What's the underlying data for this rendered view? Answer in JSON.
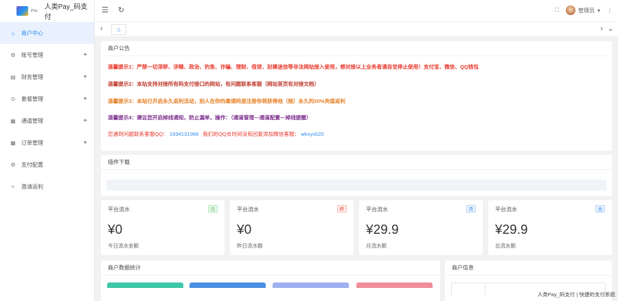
{
  "app": {
    "logo_small": "iPay",
    "title": "人类Pay_码支付"
  },
  "sidebar": {
    "items": [
      {
        "label": "商户中心",
        "icon": "home-icon",
        "glyph": "⌂",
        "active": true,
        "expandable": false
      },
      {
        "label": "账号管理",
        "icon": "gear-icon",
        "glyph": "⚙",
        "active": false,
        "expandable": true
      },
      {
        "label": "财务管理",
        "icon": "finance-icon",
        "glyph": "▤",
        "active": false,
        "expandable": true
      },
      {
        "label": "套餐管理",
        "icon": "package-icon",
        "glyph": "⊙",
        "active": false,
        "expandable": true
      },
      {
        "label": "通道管理",
        "icon": "channel-icon",
        "glyph": "▦",
        "active": false,
        "expandable": true
      },
      {
        "label": "订单管理",
        "icon": "order-icon",
        "glyph": "▦",
        "active": false,
        "expandable": true
      },
      {
        "label": "支付配置",
        "icon": "settings-icon",
        "glyph": "⚙",
        "active": false,
        "expandable": false
      },
      {
        "label": "邀请返利",
        "icon": "share-icon",
        "glyph": "<",
        "active": false,
        "expandable": false
      }
    ],
    "expand_glyph": "+"
  },
  "header": {
    "user_label": "管理员",
    "menu_glyph": "☰",
    "refresh_glyph": "↻",
    "fullscreen_glyph": "⛶",
    "more_glyph": "⋮",
    "caret_glyph": "▾"
  },
  "tabs": {
    "prev_glyph": "‹",
    "next_glyph": "›",
    "dropdown_glyph": "⌄",
    "home_glyph": "⌂"
  },
  "notice": {
    "title": "商户公告",
    "lines": [
      "温馨提示1：严禁一切淫秽、涉赌、政治、钓鱼、诈骗、理财、借贷、封建迷信等非法网站接入使用，想对接以上业务者请自觉停止使用！支付宝、微信、QQ钱包",
      "温馨提示2：本站支持对接所有码支付接口的网站，有问题联系客服（网站首页有对接文档）",
      "温馨提示3：本站已开启永久返利活动，别人在你的邀请码里注册你将获得他（她）永久的20%充值返利",
      "温馨提示4：建议您开启掉线通知，防止漏单，操作：（通道管理—通道配置—掉线提醒）"
    ],
    "contact_prefix": "您遇到问题联系客服QQ：",
    "contact_qq": "1934131068",
    "contact_mid": "我们的QQ长时间没有回复添加微信客服：",
    "contact_wechat": "wkxys520"
  },
  "plugin": {
    "title": "插件下载"
  },
  "stats": [
    {
      "title": "平台流水",
      "badge": "日",
      "value": "¥0",
      "sub": "今日流水金额",
      "badge_color": "#5cb85c"
    },
    {
      "title": "平台流水",
      "badge": "昨",
      "value": "¥0",
      "sub": "昨日流水额",
      "badge_color": "#e8372a"
    },
    {
      "title": "平台流水",
      "badge": "月",
      "value": "¥29.9",
      "sub": "月流水额",
      "badge_color": "#2d8cf0"
    },
    {
      "title": "平台流水",
      "badge": "总",
      "value": "¥29.9",
      "sub": "总流水额",
      "badge_color": "#2d8cf0"
    }
  ],
  "merchant_stats": {
    "title": "商户数据统计",
    "bar_colors": [
      "#3ec7a7",
      "#4a90e2",
      "#9fb0ef",
      "#ef8e9c"
    ]
  },
  "merchant_info": {
    "title": "商户信息"
  },
  "footer": {
    "text": "人类Pay_码支付 | 快捷的支付系统"
  },
  "colors": {
    "accent": "#2d8cf0",
    "warning_red": "#e8372a"
  }
}
